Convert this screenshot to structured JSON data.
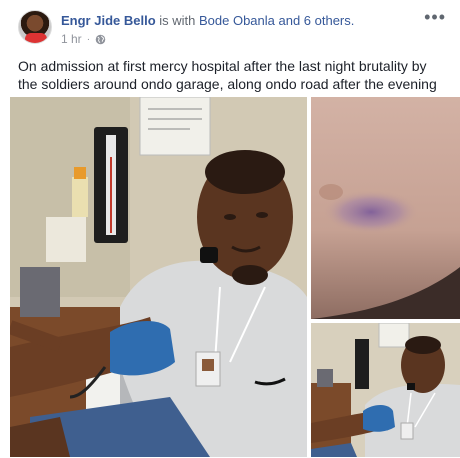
{
  "post": {
    "author": "Engr Jide Bello",
    "with_text": " is with ",
    "tagged": "Bode Obanla and 6 others.",
    "timestamp": "1 hr",
    "privacy_icon": "globe-icon",
    "more_icon": "more-options-icon",
    "more_label": "•••",
    "text": "On admission at first mercy hospital after the last night brutality by the soldiers around ondo garage, along ondo road after the evening news"
  },
  "photos": [
    {
      "name": "man-on-drip-photo",
      "icon": "photo"
    },
    {
      "name": "bruise-closeup-photo",
      "icon": "photo"
    },
    {
      "name": "man-bp-check-photo",
      "icon": "photo"
    }
  ],
  "colors": {
    "link": "#365899",
    "meta": "#90949c",
    "text": "#1d2129"
  }
}
